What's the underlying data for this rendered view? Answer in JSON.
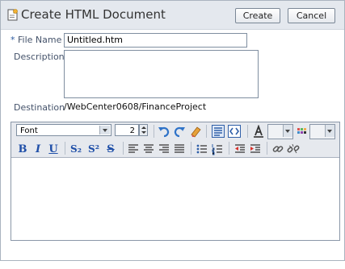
{
  "dialog": {
    "title": "Create HTML Document",
    "create_label": "Create",
    "cancel_label": "Cancel"
  },
  "form": {
    "required_marker": "*",
    "file_name_label": "File Name",
    "file_name_value": "Untitled.htm",
    "description_label": "Description",
    "description_value": "",
    "destination_label": "Destination",
    "destination_value": "/WebCenter0608/FinanceProject"
  },
  "toolbar": {
    "font_select": "Font",
    "size_value": "2",
    "bold": "B",
    "italic": "I",
    "underline": "U",
    "subscript": "S₂",
    "superscript": "S²",
    "strikethrough": "S"
  },
  "icons": {
    "document": "new-document-icon",
    "undo": "undo-icon",
    "redo": "redo-icon",
    "eraser": "eraser-icon",
    "rich_text_mode": "rich-text-mode-icon",
    "source_mode": "source-code-mode-icon",
    "font_color": "font-color-icon",
    "background_color": "background-color-icon",
    "align_left": "align-left-icon",
    "align_center": "align-center-icon",
    "align_right": "align-right-icon",
    "justify": "justify-icon",
    "bullet_list": "bullet-list-icon",
    "numbered_list": "numbered-list-icon",
    "outdent": "outdent-icon",
    "indent": "indent-icon",
    "link": "link-icon",
    "unlink": "unlink-icon"
  },
  "colors": {
    "accent": "#1f4fa8",
    "titlebar": "#e4e8ee",
    "label": "#44526a"
  }
}
